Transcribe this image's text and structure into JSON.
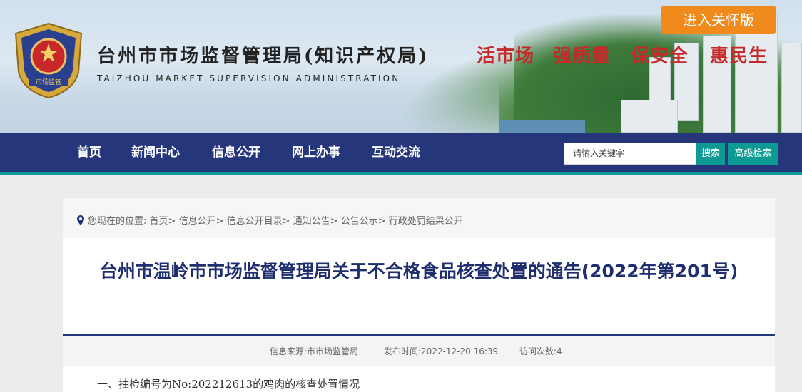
{
  "header": {
    "title_cn": "台州市市场监督管理局(知识产权局)",
    "title_en": "TAIZHOU MARKET SUPERVISION ADMINISTRATION",
    "emblem_text": "市场监管",
    "slogans": [
      "活市场",
      "强质量",
      "保安全",
      "惠民生"
    ],
    "care_button": "进入关怀版"
  },
  "nav": {
    "items": [
      "首页",
      "新闻中心",
      "信息公开",
      "网上办事",
      "互动交流"
    ],
    "search_placeholder": "请输入关键字",
    "search_button": "搜索",
    "advanced_button": "高级检索"
  },
  "breadcrumb": {
    "prefix": "您现在的位置:",
    "items": [
      "首页>",
      "信息公开>",
      "信息公开目录>",
      "通知公告>",
      "公告公示>",
      "行政处罚结果公开"
    ]
  },
  "article": {
    "title": "台州市温岭市市场监督管理局关于不合格食品核查处置的通告(2022年第201号)",
    "source_label": "信息来源:",
    "source": "市市场监管局",
    "date_label": "发布时间:",
    "date": "2022-12-20 16:39",
    "views_label": "访问次数:",
    "views": "4",
    "first_line": "一、抽检编号为No:202212613的鸡肉的核查处置情况"
  },
  "colors": {
    "nav_bg": "#26367a",
    "accent_teal": "#129d9a",
    "care_orange": "#f08a1c",
    "slogan_red": "#c8282a",
    "title_navy": "#1f2e6e"
  }
}
